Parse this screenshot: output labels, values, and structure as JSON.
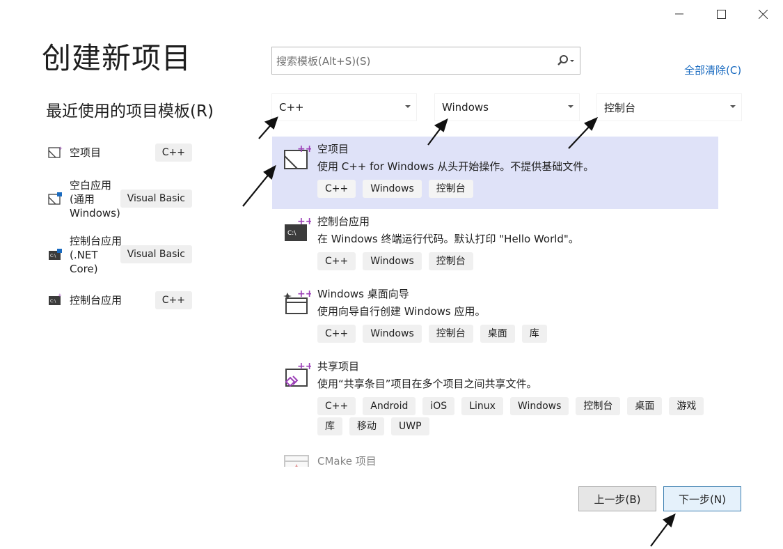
{
  "window": {
    "minimize_icon": "minimize-icon",
    "maximize_icon": "maximize-icon",
    "close_icon": "close-icon"
  },
  "header": {
    "title": "创建新项目",
    "recent_title": "最近使用的项目模板(R)"
  },
  "recent": [
    {
      "label": "空项目",
      "tag": "C++"
    },
    {
      "label": "空白应用\n(通用\nWindows)",
      "tag": "Visual Basic"
    },
    {
      "label": "控制台应用\n(.NET\nCore)",
      "tag": "Visual Basic"
    },
    {
      "label": "控制台应用",
      "tag": "C++"
    }
  ],
  "search": {
    "placeholder": "搜索模板(Alt+S)(S)",
    "icon": "search-icon"
  },
  "clear_all": "全部清除(C)",
  "filters": {
    "language": "C++",
    "platform": "Windows",
    "project_type": "控制台"
  },
  "templates": [
    {
      "name": "空项目",
      "desc": "使用 C++ for Windows 从头开始操作。不提供基础文件。",
      "tags": [
        "C++",
        "Windows",
        "控制台"
      ],
      "selected": true
    },
    {
      "name": "控制台应用",
      "desc": "在 Windows 终端运行代码。默认打印 \"Hello World\"。",
      "tags": [
        "C++",
        "Windows",
        "控制台"
      ]
    },
    {
      "name": "Windows 桌面向导",
      "desc": "使用向导自行创建 Windows 应用。",
      "tags": [
        "C++",
        "Windows",
        "控制台",
        "桌面",
        "库"
      ]
    },
    {
      "name": "共享项目",
      "desc": "使用“共享条目”项目在多个项目之间共享文件。",
      "tags": [
        "C++",
        "Android",
        "iOS",
        "Linux",
        "Windows",
        "控制台",
        "桌面",
        "游戏",
        "库",
        "移动",
        "UWP"
      ]
    },
    {
      "name": "CMake 项目",
      "desc": "",
      "tags": []
    }
  ],
  "buttons": {
    "back": "上一步(B)",
    "next": "下一步(N)"
  },
  "colors": {
    "selected_bg": "#dfe2f8",
    "link": "#1a6bc0",
    "icon_accent": "#9b3fb7"
  }
}
